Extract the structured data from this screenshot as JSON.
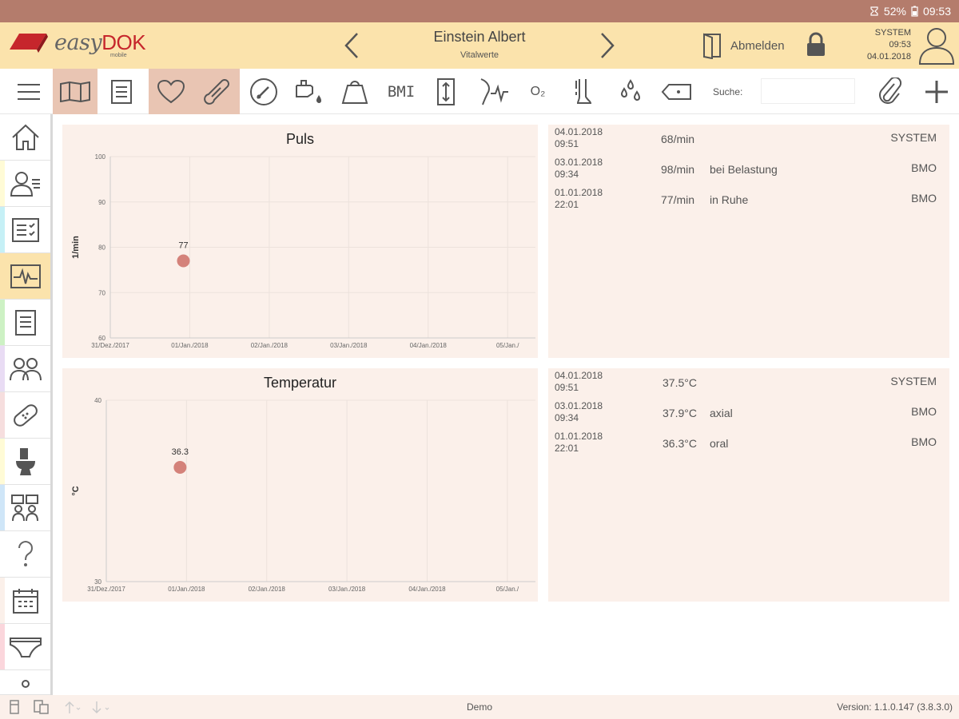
{
  "status_bar": {
    "battery": "52%",
    "time": "09:53"
  },
  "header": {
    "app_name_prefix": "easy",
    "app_name_suffix": "DOK",
    "app_name_sub": "mobile",
    "patient_name": "Einstein Albert",
    "patient_subtitle": "Vitalwerte",
    "logout_label": "Abmelden",
    "user": "SYSTEM",
    "time": "09:53",
    "date": "04.01.2018"
  },
  "toolbar": {
    "bmi_label": "BMI",
    "o2_label": "O₂",
    "search_label": "Suche:",
    "search_value": ""
  },
  "sidebar": {
    "stripe_colors": [
      "#ffffff",
      "#fffbd6",
      "#c6f0f6",
      "#fbe3ac",
      "#cdf1c4",
      "#e9dcf4",
      "#f6dede",
      "#fffbd6",
      "#cfe6f8",
      "#ffffff",
      "#fbf0ea",
      "#fbd6dc",
      "#ffffff"
    ]
  },
  "pulse": {
    "title": "Puls",
    "ylabel": "1/min",
    "ytick_labels": [
      "100",
      "90",
      "80",
      "70",
      "60"
    ],
    "xtick_labels": [
      "31/Dez./2017",
      "01/Jan./2018",
      "02/Jan./2018",
      "03/Jan./2018",
      "04/Jan./2018",
      "05/Jan./"
    ],
    "point_label": "77",
    "records": [
      {
        "date": "04.01.2018",
        "time": "09:51",
        "value": "68/min",
        "note": "",
        "user": "SYSTEM"
      },
      {
        "date": "03.01.2018",
        "time": "09:34",
        "value": "98/min",
        "note": "bei Belastung",
        "user": "BMO"
      },
      {
        "date": "01.01.2018",
        "time": "22:01",
        "value": "77/min",
        "note": "in Ruhe",
        "user": "BMO"
      }
    ]
  },
  "temperature": {
    "title": "Temperatur",
    "ylabel": "°C",
    "ytick_labels": [
      "40",
      "30"
    ],
    "xtick_labels": [
      "31/Dez./2017",
      "01/Jan./2018",
      "02/Jan./2018",
      "03/Jan./2018",
      "04/Jan./2018",
      "05/Jan./"
    ],
    "point_label": "36.3",
    "records": [
      {
        "date": "04.01.2018",
        "time": "09:51",
        "value": "37.5°C",
        "note": "",
        "user": "SYSTEM"
      },
      {
        "date": "03.01.2018",
        "time": "09:34",
        "value": "37.9°C",
        "note": "axial",
        "user": "BMO"
      },
      {
        "date": "01.01.2018",
        "time": "22:01",
        "value": "36.3°C",
        "note": "oral",
        "user": "BMO"
      }
    ]
  },
  "chart_data": [
    {
      "type": "scatter",
      "title": "Puls",
      "xlabel": "",
      "ylabel": "1/min",
      "x_categories": [
        "31/Dez./2017",
        "01/Jan./2018",
        "02/Jan./2018",
        "03/Jan./2018",
        "04/Jan./2018",
        "05/Jan./"
      ],
      "ylim": [
        60,
        100
      ],
      "points": [
        {
          "x": "01/Jan./2018 22:01",
          "x_index": 0.92,
          "y": 77,
          "label": "77"
        }
      ],
      "grid": true,
      "point_color": "#d4827a"
    },
    {
      "type": "scatter",
      "title": "Temperatur",
      "xlabel": "",
      "ylabel": "°C",
      "x_categories": [
        "31/Dez./2017",
        "01/Jan./2018",
        "02/Jan./2018",
        "03/Jan./2018",
        "04/Jan./2018",
        "05/Jan./"
      ],
      "ylim": [
        30,
        40
      ],
      "points": [
        {
          "x": "01/Jan./2018 22:01",
          "x_index": 0.92,
          "y": 36.3,
          "label": "36.3"
        }
      ],
      "grid": true,
      "point_color": "#d4827a"
    }
  ],
  "footer": {
    "center_text": "Demo",
    "version": "Version:  1.1.0.147 (3.8.3.0)"
  }
}
